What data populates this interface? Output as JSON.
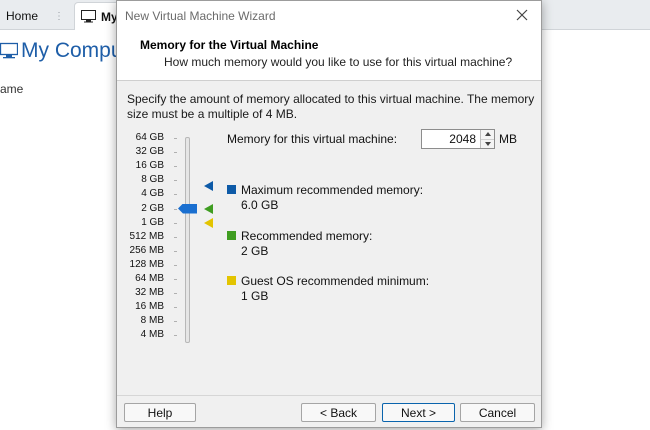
{
  "background_app": {
    "tabs": [
      {
        "label": "Home",
        "icon": "home-icon"
      },
      {
        "label": "My",
        "icon": "computer-icon"
      }
    ],
    "page_title": "My Compu",
    "column_header": "ame"
  },
  "dialog": {
    "title": "New Virtual Machine Wizard",
    "header_title": "Memory for the Virtual Machine",
    "header_subtitle": "How much memory would you like to use for this virtual machine?",
    "description": "Specify the amount of memory allocated to this virtual machine. The memory size must be a multiple of 4 MB.",
    "memory_label": "Memory for this virtual machine:",
    "memory_value": "2048",
    "memory_unit": "MB",
    "scale_ticks": [
      "64 GB",
      "32 GB",
      "16 GB",
      "8 GB",
      "4 GB",
      "2 GB",
      "1 GB",
      "512 MB",
      "256 MB",
      "128 MB",
      "64 MB",
      "32 MB",
      "16 MB",
      "8 MB",
      "4 MB"
    ],
    "slider_value": "2 GB",
    "legend": [
      {
        "label": "Maximum recommended memory:",
        "value": "6.0 GB",
        "color": "#0d5aa7"
      },
      {
        "label": "Recommended memory:",
        "value": "2 GB",
        "color": "#3f9d21"
      },
      {
        "label": "Guest OS recommended minimum:",
        "value": "1 GB",
        "color": "#e3c400"
      }
    ],
    "buttons": {
      "help": "Help",
      "back": "< Back",
      "next": "Next >",
      "cancel": "Cancel"
    }
  }
}
